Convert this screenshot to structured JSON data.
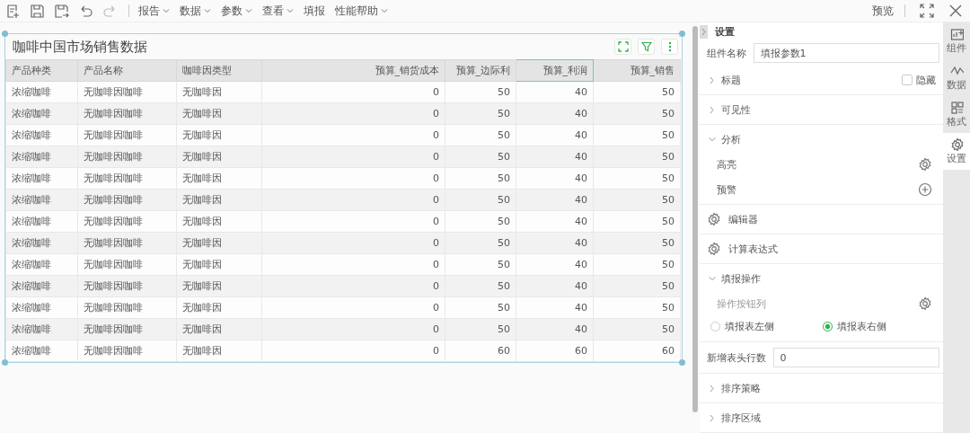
{
  "toolbar": {
    "icons": [
      {
        "kind": "new",
        "disabled": false
      },
      {
        "kind": "save",
        "disabled": false
      },
      {
        "kind": "save-as",
        "disabled": false
      },
      {
        "kind": "undo",
        "disabled": false
      },
      {
        "kind": "redo",
        "disabled": true
      }
    ],
    "menus": [
      {
        "label": "报告",
        "dropdown": true
      },
      {
        "label": "数据",
        "dropdown": true
      },
      {
        "label": "参数",
        "dropdown": true
      },
      {
        "label": "查看",
        "dropdown": true
      },
      {
        "label": "填报",
        "dropdown": false
      },
      {
        "label": "性能帮助",
        "dropdown": true
      }
    ],
    "preview": "预览"
  },
  "widget": {
    "title": "咖啡中国市场销售数据",
    "columns": [
      {
        "label": "产品种类",
        "kind": "text",
        "selected": false
      },
      {
        "label": "产品名称",
        "kind": "text",
        "selected": false
      },
      {
        "label": "咖啡因类型",
        "kind": "text",
        "selected": false
      },
      {
        "label": "预算_销货成本",
        "kind": "number",
        "selected": false
      },
      {
        "label": "预算_边际利",
        "kind": "number",
        "selected": false
      },
      {
        "label": "预算_利润",
        "kind": "number",
        "selected": true
      },
      {
        "label": "预算_销售",
        "kind": "number",
        "selected": false
      }
    ],
    "rows": [
      [
        "浓缩咖啡",
        "无咖啡因咖啡",
        "无咖啡因",
        "0",
        "50",
        "40",
        "50"
      ],
      [
        "浓缩咖啡",
        "无咖啡因咖啡",
        "无咖啡因",
        "0",
        "50",
        "40",
        "50"
      ],
      [
        "浓缩咖啡",
        "无咖啡因咖啡",
        "无咖啡因",
        "0",
        "50",
        "40",
        "50"
      ],
      [
        "浓缩咖啡",
        "无咖啡因咖啡",
        "无咖啡因",
        "0",
        "50",
        "40",
        "50"
      ],
      [
        "浓缩咖啡",
        "无咖啡因咖啡",
        "无咖啡因",
        "0",
        "50",
        "40",
        "50"
      ],
      [
        "浓缩咖啡",
        "无咖啡因咖啡",
        "无咖啡因",
        "0",
        "50",
        "40",
        "50"
      ],
      [
        "浓缩咖啡",
        "无咖啡因咖啡",
        "无咖啡因",
        "0",
        "50",
        "40",
        "50"
      ],
      [
        "浓缩咖啡",
        "无咖啡因咖啡",
        "无咖啡因",
        "0",
        "50",
        "40",
        "50"
      ],
      [
        "浓缩咖啡",
        "无咖啡因咖啡",
        "无咖啡因",
        "0",
        "50",
        "40",
        "50"
      ],
      [
        "浓缩咖啡",
        "无咖啡因咖啡",
        "无咖啡因",
        "0",
        "50",
        "40",
        "50"
      ],
      [
        "浓缩咖啡",
        "无咖啡因咖啡",
        "无咖啡因",
        "0",
        "50",
        "40",
        "50"
      ],
      [
        "浓缩咖啡",
        "无咖啡因咖啡",
        "无咖啡因",
        "0",
        "50",
        "40",
        "50"
      ],
      [
        "浓缩咖啡",
        "无咖啡因咖啡",
        "无咖啡因",
        "0",
        "60",
        "60",
        "60"
      ]
    ]
  },
  "panel": {
    "title": "设置",
    "name_field": {
      "label": "组件名称",
      "value": "填报参数1"
    },
    "sections": [
      {
        "kind": "group",
        "label": "标题",
        "expanded": false,
        "checkbox": {
          "label": "隐藏",
          "checked": false
        }
      },
      {
        "kind": "group",
        "label": "可见性",
        "expanded": false
      },
      {
        "kind": "group",
        "label": "分析",
        "expanded": true,
        "items": [
          {
            "label": "高亮",
            "kind": "gear",
            "disabled": false
          },
          {
            "label": "预警",
            "kind": "plus",
            "disabled": false
          }
        ]
      },
      {
        "kind": "tool",
        "label": "编辑器"
      },
      {
        "kind": "tool",
        "label": "计算表达式"
      },
      {
        "kind": "group",
        "label": "填报操作",
        "expanded": true,
        "items": [
          {
            "label": "操作按钮列",
            "kind": "gear",
            "disabled": true
          }
        ],
        "radios": [
          {
            "label": "填报表左侧",
            "selected": false
          },
          {
            "label": "填报表右侧",
            "selected": true
          }
        ]
      },
      {
        "kind": "input",
        "label": "新增表头行数",
        "value": "0"
      },
      {
        "kind": "group",
        "label": "排序策略",
        "expanded": false
      },
      {
        "kind": "group",
        "label": "排序区域",
        "expanded": false
      }
    ]
  },
  "side_tabs": [
    {
      "label": "组件",
      "kind": "widget",
      "selected": false
    },
    {
      "label": "数据",
      "kind": "data",
      "selected": false
    },
    {
      "label": "格式",
      "kind": "format",
      "selected": false
    },
    {
      "label": "设置",
      "kind": "gear",
      "selected": true
    }
  ]
}
